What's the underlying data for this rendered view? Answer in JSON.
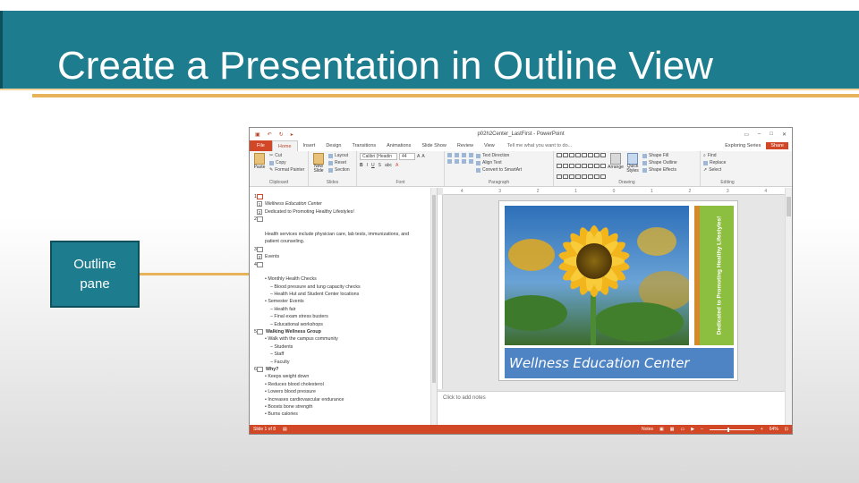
{
  "slide": {
    "title": "Create a Presentation in Outline View",
    "callout": "Outline\npane"
  },
  "window": {
    "doc_title": "p02h2Center_LastFirst - PowerPoint",
    "tabs": [
      "File",
      "Home",
      "Insert",
      "Design",
      "Transitions",
      "Animations",
      "Slide Show",
      "Review",
      "View"
    ],
    "active_tab": "Home",
    "tell_me": "Tell me what you want to do...",
    "account": "Exploring Series",
    "share": "Share"
  },
  "ribbon": {
    "clipboard": {
      "name": "Clipboard",
      "paste": "Paste",
      "cut": "Cut",
      "copy": "Copy",
      "format_painter": "Format Painter"
    },
    "slides": {
      "name": "Slides",
      "new_slide": "New Slide",
      "layout": "Layout",
      "reset": "Reset",
      "section": "Section"
    },
    "font": {
      "name": "Font",
      "font_name": "Calibri (Headin",
      "font_size": "44"
    },
    "paragraph": {
      "name": "Paragraph",
      "text_direction": "Text Direction",
      "align_text": "Align Text",
      "smartart": "Convert to SmartArt"
    },
    "drawing": {
      "name": "Drawing",
      "arrange": "Arrange",
      "quick_styles": "Quick Styles",
      "shape_fill": "Shape Fill",
      "shape_outline": "Shape Outline",
      "shape_effects": "Shape Effects"
    },
    "editing": {
      "name": "Editing",
      "find": "Find",
      "replace": "Replace",
      "select": "Select"
    }
  },
  "outline": {
    "lines": [
      {
        "num": "1",
        "thumb": true,
        "sel": true,
        "indent": 0,
        "text": ""
      },
      {
        "num": "",
        "level": "1",
        "indent": 1,
        "text": "Wellness Education Center",
        "style": "italic"
      },
      {
        "num": "",
        "level": "2",
        "indent": 1,
        "text": "Dedicated to Promoting Healthy Lifestyles!",
        "style": ""
      },
      {
        "num": "2",
        "thumb": true,
        "indent": 0,
        "text": ""
      },
      {
        "num": "",
        "indent": 1,
        "text": "",
        "style": ""
      },
      {
        "num": "",
        "indent": 1,
        "text": "Health services include physician care, lab tests, immunizations, and",
        "style": ""
      },
      {
        "num": "",
        "indent": 1,
        "text": "patient counseling.",
        "style": ""
      },
      {
        "num": "3",
        "thumb": true,
        "indent": 0,
        "text": ""
      },
      {
        "num": "",
        "level": "2",
        "indent": 1,
        "text": "Events",
        "style": ""
      },
      {
        "num": "4",
        "thumb": true,
        "indent": 0,
        "text": ""
      },
      {
        "num": "",
        "indent": 1,
        "text": "",
        "style": ""
      },
      {
        "num": "",
        "indent": 1,
        "text": "• Monthly Health Checks",
        "style": ""
      },
      {
        "num": "",
        "indent": 2,
        "text": "– Blood pressure and lung capacity checks",
        "style": ""
      },
      {
        "num": "",
        "indent": 2,
        "text": "– Health Hut and Student Center locations",
        "style": ""
      },
      {
        "num": "",
        "indent": 1,
        "text": "• Semester Events",
        "style": ""
      },
      {
        "num": "",
        "indent": 2,
        "text": "– Health fair",
        "style": ""
      },
      {
        "num": "",
        "indent": 2,
        "text": "– Final exam stress busters",
        "style": ""
      },
      {
        "num": "",
        "indent": 2,
        "text": "– Educational workshops",
        "style": ""
      },
      {
        "num": "5",
        "thumb": true,
        "indent": 0,
        "text": "Walking Wellness Group",
        "style": "bold"
      },
      {
        "num": "",
        "indent": 1,
        "text": "• Walk with the campus community",
        "style": ""
      },
      {
        "num": "",
        "indent": 2,
        "text": "– Students",
        "style": ""
      },
      {
        "num": "",
        "indent": 2,
        "text": "– Staff",
        "style": ""
      },
      {
        "num": "",
        "indent": 2,
        "text": "– Faculty",
        "style": ""
      },
      {
        "num": "6",
        "thumb": true,
        "indent": 0,
        "text": "Why?",
        "style": "bold"
      },
      {
        "num": "",
        "indent": 1,
        "text": "• Keeps weight down",
        "style": ""
      },
      {
        "num": "",
        "indent": 1,
        "text": "• Reduces blood cholesterol",
        "style": ""
      },
      {
        "num": "",
        "indent": 1,
        "text": "• Lowers blood pressure",
        "style": ""
      },
      {
        "num": "",
        "indent": 1,
        "text": "• Increases cardiovascular endurance",
        "style": ""
      },
      {
        "num": "",
        "indent": 1,
        "text": "• Boosts bone strength",
        "style": ""
      },
      {
        "num": "",
        "indent": 1,
        "text": "• Burns calories",
        "style": ""
      }
    ]
  },
  "preview": {
    "banner": "Wellness Education Center",
    "vertical": "Dedicated to Promoting Healthy Lifestyles!",
    "notes_placeholder": "Click to add notes",
    "ruler": [
      "4",
      "3",
      "2",
      "1",
      "0",
      "1",
      "2",
      "3",
      "4"
    ]
  },
  "status": {
    "slide_of": "Slide 1 of 8",
    "notes": "Notes",
    "zoom": "64%"
  },
  "colors": {
    "title_bg": "#1d7c8d",
    "accent": "#e8b25b",
    "ppt_orange": "#d24726"
  }
}
